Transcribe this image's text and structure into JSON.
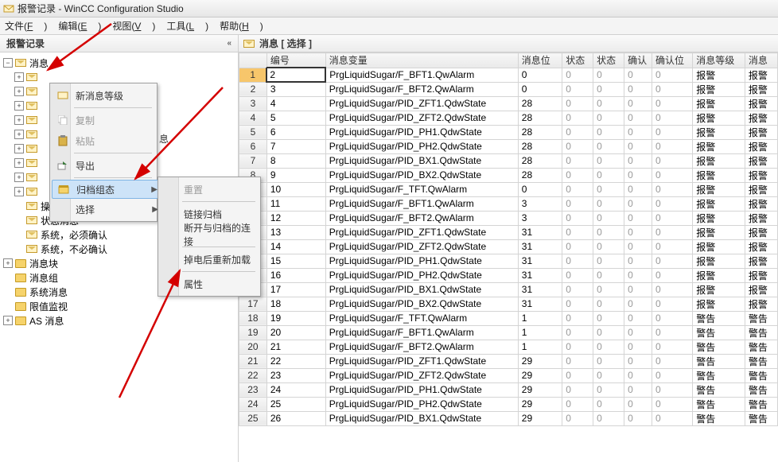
{
  "window": {
    "title": "报警记录 - WinCC Configuration Studio"
  },
  "menubar": [
    {
      "label": "文件",
      "hot": "F"
    },
    {
      "label": "编辑",
      "hot": "E"
    },
    {
      "label": "视图",
      "hot": "V"
    },
    {
      "label": "工具",
      "hot": "L"
    },
    {
      "label": "帮助",
      "hot": "H"
    }
  ],
  "sidebar": {
    "title": "报警记录",
    "root": "消息",
    "visible_children": [
      "操作员输入消息",
      "状态消息",
      "系统，必须确认",
      "系统，不必确认"
    ],
    "extras": [
      "消息块",
      "消息组",
      "系统消息",
      "限值监视",
      "AS 消息"
    ]
  },
  "ctx1": {
    "items": [
      {
        "label": "新消息等级",
        "icon": "new"
      },
      {
        "label": "复制",
        "icon": "copy",
        "dis": true
      },
      {
        "label": "粘贴",
        "icon": "paste",
        "dis": true
      },
      {
        "label": "导出",
        "icon": "export"
      },
      {
        "label": "归档组态",
        "icon": "archive",
        "sel": true,
        "sub": true
      },
      {
        "label": "选择",
        "sub": true
      }
    ],
    "bottom": "息"
  },
  "ctx2": {
    "items": [
      {
        "label": "重置",
        "dis": true
      },
      {
        "label": "链接归档"
      },
      {
        "label": "断开与归档的连接"
      },
      {
        "label": "掉电后重新加载"
      },
      {
        "label": "属性"
      }
    ]
  },
  "content": {
    "title": "消息 [ 选择 ]",
    "columns": [
      "编号",
      "消息变量",
      "消息位",
      "状态",
      "状态",
      "确认",
      "确认位",
      "消息等级",
      "消息"
    ],
    "rows": [
      {
        "n": "2",
        "var": "PrgLiquidSugar/F_BFT1.QwAlarm",
        "bit": "0",
        "lvl": "报警",
        "m": "报警"
      },
      {
        "n": "3",
        "var": "PrgLiquidSugar/F_BFT2.QwAlarm",
        "bit": "0",
        "lvl": "报警",
        "m": "报警"
      },
      {
        "n": "4",
        "var": "PrgLiquidSugar/PID_ZFT1.QdwState",
        "bit": "28",
        "lvl": "报警",
        "m": "报警"
      },
      {
        "n": "5",
        "var": "PrgLiquidSugar/PID_ZFT2.QdwState",
        "bit": "28",
        "lvl": "报警",
        "m": "报警"
      },
      {
        "n": "6",
        "var": "PrgLiquidSugar/PID_PH1.QdwState",
        "bit": "28",
        "lvl": "报警",
        "m": "报警"
      },
      {
        "n": "7",
        "var": "PrgLiquidSugar/PID_PH2.QdwState",
        "bit": "28",
        "lvl": "报警",
        "m": "报警"
      },
      {
        "n": "8",
        "var": "PrgLiquidSugar/PID_BX1.QdwState",
        "bit": "28",
        "lvl": "报警",
        "m": "报警"
      },
      {
        "n": "9",
        "var": "PrgLiquidSugar/PID_BX2.QdwState",
        "bit": "28",
        "lvl": "报警",
        "m": "报警"
      },
      {
        "n": "10",
        "var": "PrgLiquidSugar/F_TFT.QwAlarm",
        "bit": "0",
        "lvl": "报警",
        "m": "报警"
      },
      {
        "n": "11",
        "var": "PrgLiquidSugar/F_BFT1.QwAlarm",
        "bit": "3",
        "lvl": "报警",
        "m": "报警"
      },
      {
        "n": "12",
        "var": "PrgLiquidSugar/F_BFT2.QwAlarm",
        "bit": "3",
        "lvl": "报警",
        "m": "报警"
      },
      {
        "n": "13",
        "var": "PrgLiquidSugar/PID_ZFT1.QdwState",
        "bit": "31",
        "lvl": "报警",
        "m": "报警"
      },
      {
        "n": "14",
        "var": "PrgLiquidSugar/PID_ZFT2.QdwState",
        "bit": "31",
        "lvl": "报警",
        "m": "报警"
      },
      {
        "n": "15",
        "var": "PrgLiquidSugar/PID_PH1.QdwState",
        "bit": "31",
        "lvl": "报警",
        "m": "报警"
      },
      {
        "n": "16",
        "var": "PrgLiquidSugar/PID_PH2.QdwState",
        "bit": "31",
        "lvl": "报警",
        "m": "报警"
      },
      {
        "n": "17",
        "var": "PrgLiquidSugar/PID_BX1.QdwState",
        "bit": "31",
        "lvl": "报警",
        "m": "报警"
      },
      {
        "n": "18",
        "var": "PrgLiquidSugar/PID_BX2.QdwState",
        "bit": "31",
        "lvl": "报警",
        "m": "报警"
      },
      {
        "n": "19",
        "var": "PrgLiquidSugar/F_TFT.QwAlarm",
        "bit": "1",
        "lvl": "警告",
        "m": "警告"
      },
      {
        "n": "20",
        "var": "PrgLiquidSugar/F_BFT1.QwAlarm",
        "bit": "1",
        "lvl": "警告",
        "m": "警告"
      },
      {
        "n": "21",
        "var": "PrgLiquidSugar/F_BFT2.QwAlarm",
        "bit": "1",
        "lvl": "警告",
        "m": "警告"
      },
      {
        "n": "22",
        "var": "PrgLiquidSugar/PID_ZFT1.QdwState",
        "bit": "29",
        "lvl": "警告",
        "m": "警告"
      },
      {
        "n": "23",
        "var": "PrgLiquidSugar/PID_ZFT2.QdwState",
        "bit": "29",
        "lvl": "警告",
        "m": "警告"
      },
      {
        "n": "24",
        "var": "PrgLiquidSugar/PID_PH1.QdwState",
        "bit": "29",
        "lvl": "警告",
        "m": "警告"
      },
      {
        "n": "25",
        "var": "PrgLiquidSugar/PID_PH2.QdwState",
        "bit": "29",
        "lvl": "警告",
        "m": "警告"
      },
      {
        "n": "26",
        "var": "PrgLiquidSugar/PID_BX1.QdwState",
        "bit": "29",
        "lvl": "警告",
        "m": "警告"
      }
    ],
    "zeros": "0"
  }
}
